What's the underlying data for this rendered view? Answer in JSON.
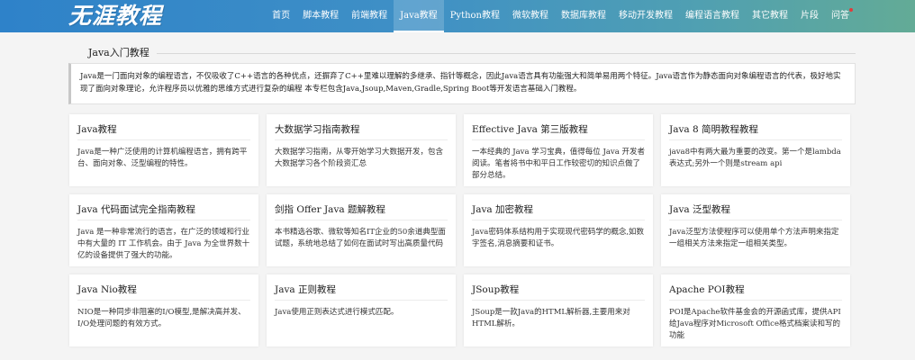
{
  "header": {
    "logo_text": "无涯教程",
    "nav": [
      {
        "label": "首页"
      },
      {
        "label": "脚本教程"
      },
      {
        "label": "前端教程"
      },
      {
        "label": "Java教程"
      },
      {
        "label": "Python教程"
      },
      {
        "label": "微软教程"
      },
      {
        "label": "数据库教程"
      },
      {
        "label": "移动开发教程"
      },
      {
        "label": "编程语言教程"
      },
      {
        "label": "其它教程"
      },
      {
        "label": "片段"
      },
      {
        "label": "问答"
      }
    ],
    "active_nav": "Java教程"
  },
  "section": {
    "title": "Java入门教程",
    "intro": "Java是一门面向对象的编程语言，不仅吸收了C++语言的各种优点，还摒弃了C++里难以理解的多继承、指针等概念，因此Java语言具有功能强大和简单易用两个特征。Java语言作为静态面向对象编程语言的代表，极好地实现了面向对象理论，允许程序员以优雅的思维方式进行复杂的编程 本专栏包含Java,Jsoup,Maven,Gradle,Spring Boot等开发语言基础入门教程。"
  },
  "cards": [
    {
      "title": "Java教程",
      "desc": "Java是一种广泛使用的计算机编程语言，拥有跨平台、面向对象、泛型编程的特性。"
    },
    {
      "title": "大数据学习指南教程",
      "desc": "大数据学习指南，从零开始学习大数据开发，包含大数据学习各个阶段资汇总"
    },
    {
      "title": "Effective Java 第三版教程",
      "desc": "一本经典的 Java 学习宝典，值得每位 Java 开发者阅读。笔者将书中和平日工作较密切的知识点做了部分总结。"
    },
    {
      "title": "Java 8 简明教程教程",
      "desc": "java8中有两大最为重要的改变。第一个是lambda表达式;另外一个则是stream api"
    },
    {
      "title": "Java 代码面试完全指南教程",
      "desc": "Java 是一种非常流行的语言，在广泛的领域和行业中有大量的 IT 工作机会。由于 Java 为全世界数十亿的设备提供了强大的功能。"
    },
    {
      "title": "剑指 Offer Java 题解教程",
      "desc": "本书精选谷歌、微软等知名IT企业的50余道典型面试题，系统地总结了如何在面试时写出高质量代码"
    },
    {
      "title": "Java 加密教程",
      "desc": "Java密码体系结构用于实现现代密码学的概念,如数字签名,消息摘要和证书。"
    },
    {
      "title": "Java 泛型教程",
      "desc": "Java泛型方法使程序可以使用单个方法声明来指定一组相关方法来指定一组相关类型。"
    },
    {
      "title": "Java Nio教程",
      "desc": "NIO是一种同步非阻塞的I/O模型,是解决高并发、I/O处理问题的有效方式。"
    },
    {
      "title": "Java 正则教程",
      "desc": "Java使用正则表达式进行模式匹配。"
    },
    {
      "title": "JSoup教程",
      "desc": "JSoup是一款Java的HTML解析器,主要用来对HTML解析。"
    },
    {
      "title": "Apache POI教程",
      "desc": "POI是Apache软件基金会的开源函式库，提供API给Java程序对Microsoft Office格式档案读和写的功能"
    }
  ]
}
